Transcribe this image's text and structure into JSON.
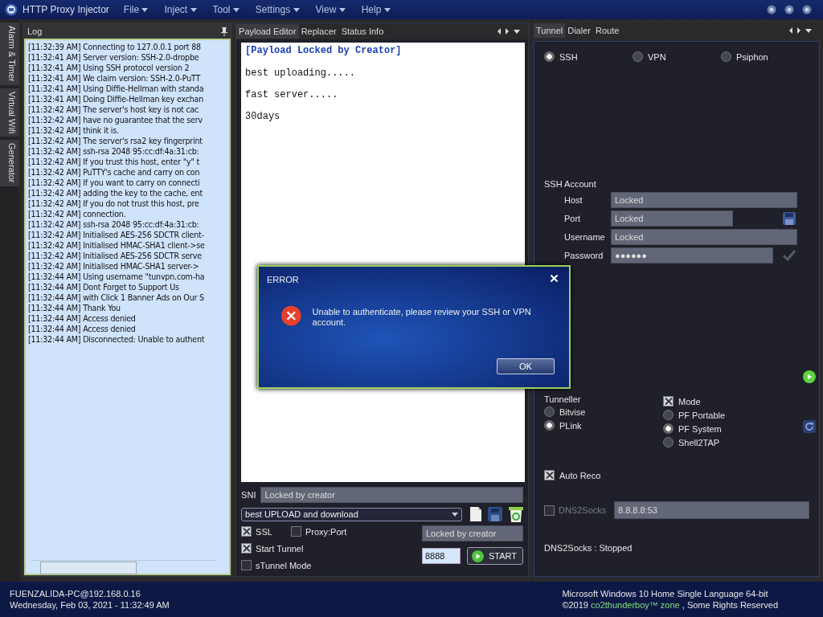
{
  "window": {
    "title": "HTTP Proxy Injector"
  },
  "menu": [
    {
      "label": "File"
    },
    {
      "label": "Inject"
    },
    {
      "label": "Tool"
    },
    {
      "label": "Settings"
    },
    {
      "label": "View"
    },
    {
      "label": "Help"
    }
  ],
  "side_tabs": [
    {
      "label": "Alarm & Timer",
      "selected": false
    },
    {
      "label": "Virtual Wifi",
      "selected": false
    },
    {
      "label": "Generator",
      "selected": false
    }
  ],
  "log": {
    "title": "Log",
    "lines": [
      "[11:32:39 AM] Connecting to 127.0.0.1 port 88",
      "[11:32:41 AM] Server version: SSH-2.0-dropbe",
      "[11:32:41 AM] Using SSH protocol version 2",
      "[11:32:41 AM] We claim version: SSH-2.0-PuTT",
      "[11:32:41 AM] Using Diffie-Hellman with standa",
      "[11:32:41 AM] Doing Diffie-Hellman key exchan",
      "[11:32:42 AM] The server's host key is not cac",
      "[11:32:42 AM] have no guarantee that the serv",
      "[11:32:42 AM] think it is.",
      "[11:32:42 AM] The server's rsa2 key fingerprint",
      "[11:32:42 AM] ssh-rsa 2048 95:cc:df:4a:31:cb:",
      "[11:32:42 AM] If you trust this host, enter \"y\" t",
      "[11:32:42 AM] PuTTY's cache and carry on con",
      "[11:32:42 AM] If you want to carry on connecti",
      "[11:32:42 AM] adding the key to the cache, ent",
      "[11:32:42 AM] If you do not trust this host, pre",
      "[11:32:42 AM] connection.",
      "[11:32:42 AM] ssh-rsa 2048 95:cc:df:4a:31:cb:",
      "[11:32:42 AM] Initialised AES-256 SDCTR client-",
      "[11:32:42 AM] Initialised HMAC-SHA1 client->se",
      "[11:32:42 AM] Initialised AES-256 SDCTR serve",
      "[11:32:42 AM] Initialised HMAC-SHA1 server->",
      "[11:32:44 AM] Using username \"tunvpn.com-ha",
      "[11:32:44 AM] Dont Forget to Support Us",
      "[11:32:44 AM] with Click 1 Banner Ads on Our S",
      "[11:32:44 AM] Thank You",
      "[11:32:44 AM] Access denied",
      "[11:32:44 AM] Access denied",
      "[11:32:44 AM] Disconnected: Unable to authent"
    ]
  },
  "payload": {
    "tabs": [
      {
        "label": "Payload Editor",
        "selected": true
      },
      {
        "label": "Replacer",
        "selected": false
      },
      {
        "label": "Status Info",
        "selected": false
      }
    ],
    "heading": "[Payload Locked by Creator]",
    "lines": [
      "best uploading.....",
      "fast server.....",
      "30days"
    ],
    "sni_label": "SNI",
    "sni_value": "Locked by creator",
    "profile": "best UPLOAD and download",
    "options": [
      {
        "label": "SSL",
        "checked": true
      },
      {
        "label": "Proxy:Port",
        "checked": false
      },
      {
        "label": "Start Tunnel",
        "checked": true
      },
      {
        "label": "sTunnel Mode",
        "checked": false
      }
    ],
    "proxy_value": "Locked by creator",
    "port": "8888",
    "start_button": "START"
  },
  "tunnel": {
    "tabs": [
      {
        "label": "Tunnel",
        "selected": true
      },
      {
        "label": "Dialer",
        "selected": false
      },
      {
        "label": "Route",
        "selected": false
      }
    ],
    "modes": [
      {
        "label": "SSH",
        "selected": true
      },
      {
        "label": "VPN",
        "selected": false
      },
      {
        "label": "Psiphon",
        "selected": false
      }
    ],
    "account_title": "SSH Account",
    "fields": [
      {
        "label": "Host",
        "value": "Locked"
      },
      {
        "label": "Port",
        "value": "Locked"
      },
      {
        "label": "Username",
        "value": "Locked"
      },
      {
        "label": "Password",
        "value": "●●●●●●"
      }
    ],
    "tunneller": {
      "label": "Tunneller",
      "options": [
        {
          "label": "Bitvise",
          "selected": false
        },
        {
          "label": "PLink",
          "selected": true
        }
      ]
    },
    "mode": {
      "label": "Mode",
      "checked": true,
      "options": [
        {
          "label": "PF Portable",
          "selected": false
        },
        {
          "label": "PF System",
          "selected": true
        },
        {
          "label": "Shell2TAP",
          "selected": false
        }
      ]
    },
    "auto_reconnect": {
      "label": "Auto Reco",
      "checked": true
    },
    "dns2socks": {
      "label": "DNS2Socks",
      "checked": false,
      "value": "8.8.8.8:53"
    },
    "dns_status": "DNS2Socks : Stopped"
  },
  "status_bar": {
    "host": "FUENZALIDA-PC@192.168.0.16",
    "datetime": "Wednesday, Feb 03, 2021 - 11:32:49 AM",
    "os": "Microsoft Windows 10 Home Single Language 64-bit",
    "copyright_prefix": "©2019",
    "brand": "co2thunderboy™ zone",
    "copyright_suffix": ", Some Rights Reserved"
  },
  "dialog": {
    "title": "ERROR",
    "message": "Unable to authenticate, please review your SSH or VPN account.",
    "button": "OK"
  }
}
